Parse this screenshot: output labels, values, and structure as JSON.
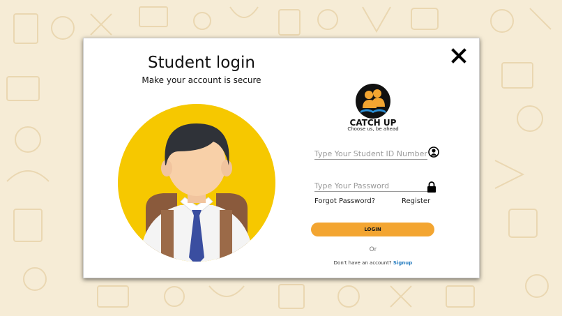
{
  "modal": {
    "title": "Student login",
    "subtitle": "Make your account is secure",
    "close_icon": "close-icon"
  },
  "brand": {
    "name": "CATCH UP",
    "tagline": "Choose us, be ahead",
    "logo_icon": "catch-up-logo"
  },
  "form": {
    "student_id_placeholder": "Type Your Student ID Number",
    "student_id_value": "",
    "password_placeholder": "Type Your Password",
    "password_value": "",
    "forgot_password_label": "Forgot Password?",
    "register_label": "Register",
    "login_label": "LOGIN",
    "or_label": "Or",
    "no_account_text": "Don't have an account?",
    "signup_label": "Signup"
  },
  "colors": {
    "accent": "#f3a531",
    "link": "#2a7fc1",
    "background": "#f6ecd6",
    "avatar_circle": "#f6c800"
  }
}
